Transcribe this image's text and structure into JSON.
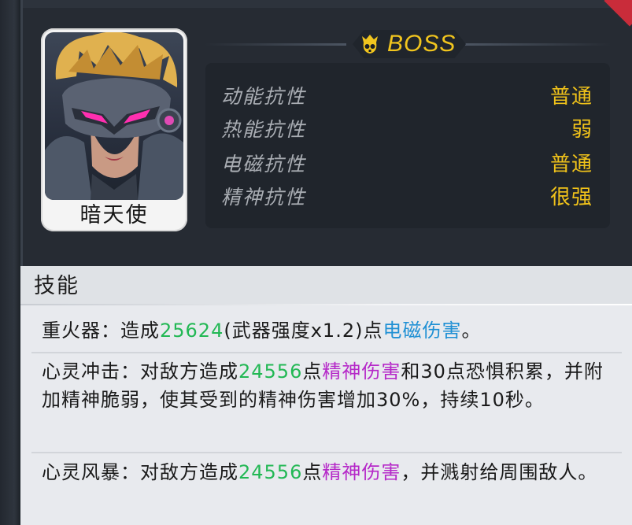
{
  "character": {
    "name": "暗天使",
    "rank_badge": "BOSS",
    "badge_color": "#f1c51e"
  },
  "resistances": [
    {
      "label": "动能抗性",
      "value": "普通"
    },
    {
      "label": "热能抗性",
      "value": "弱"
    },
    {
      "label": "电磁抗性",
      "value": "普通"
    },
    {
      "label": "精神抗性",
      "value": "很强"
    }
  ],
  "skills": {
    "title": "技能",
    "list": [
      {
        "name": "重火器",
        "sep": "：",
        "parts": [
          {
            "text": "造成",
            "style": "normal"
          },
          {
            "text": "25624",
            "style": "green"
          },
          {
            "text": "(武器强度x1.2)点",
            "style": "normal"
          },
          {
            "text": "电磁伤害",
            "style": "blue"
          },
          {
            "text": "。",
            "style": "normal"
          }
        ]
      },
      {
        "name": "心灵冲击",
        "sep": "：",
        "parts": [
          {
            "text": "对敌方造成",
            "style": "normal"
          },
          {
            "text": "24556",
            "style": "green"
          },
          {
            "text": "点",
            "style": "normal"
          },
          {
            "text": "精神伤害",
            "style": "purple"
          },
          {
            "text": "和30点恐惧积累，并附加精神脆弱，使其受到的精神伤害增加30%，持续10秒。",
            "style": "normal"
          }
        ]
      },
      {
        "name": "心灵风暴",
        "sep": "：",
        "parts": [
          {
            "text": "对敌方造成",
            "style": "normal"
          },
          {
            "text": "24556",
            "style": "green"
          },
          {
            "text": "点",
            "style": "normal"
          },
          {
            "text": "精神伤害",
            "style": "purple"
          },
          {
            "text": "，并溅射给周围敌人。",
            "style": "normal"
          }
        ]
      }
    ]
  },
  "colors": {
    "resist_value": "#f0c21a",
    "damage_number": "#22b854",
    "electromagnetic": "#1f90d4",
    "psychic": "#b528c8",
    "corner_badge": "#c92c3a"
  },
  "icons": {
    "boss": "skull-crown-icon",
    "portrait": "masked-helmet-character"
  }
}
